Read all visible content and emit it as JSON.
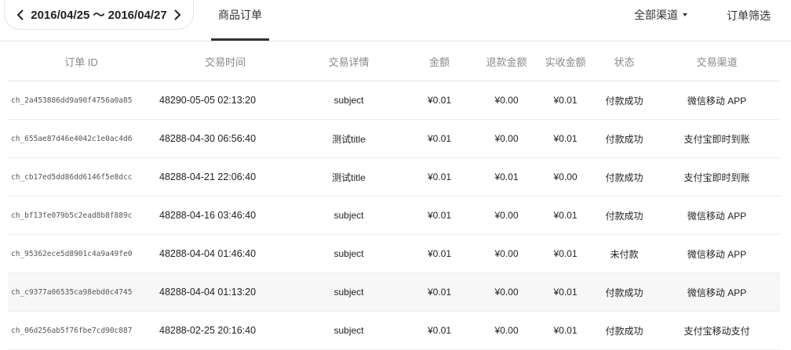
{
  "date_range": {
    "text": "2016/04/25 ～ 2016/04/27"
  },
  "tabs": {
    "active": "商品订单"
  },
  "controls": {
    "channel_dropdown": "全部渠道",
    "filter_button": "订单筛选"
  },
  "table": {
    "headers": [
      "订单 ID",
      "交易时间",
      "交易详情",
      "金额",
      "退款金额",
      "实收金额",
      "状态",
      "交易渠道"
    ],
    "rows": [
      {
        "id": "ch_2a453886dd9a90f4756a0a85",
        "time": "48290-05-05 02:13:20",
        "detail": "subject",
        "amount": "¥0.01",
        "refund": "¥0.00",
        "received": "¥0.01",
        "status": "付款成功",
        "channel": "微信移动 APP"
      },
      {
        "id": "ch_655ae87d46e4042c1e0ac4d6",
        "time": "48288-04-30 06:56:40",
        "detail": "测试title",
        "amount": "¥0.01",
        "refund": "¥0.00",
        "received": "¥0.01",
        "status": "付款成功",
        "channel": "支付宝即时到账"
      },
      {
        "id": "ch_cb17ed5dd86dd6146f5e8dcc",
        "time": "48288-04-21 22:06:40",
        "detail": "测试title",
        "amount": "¥0.01",
        "refund": "¥0.01",
        "received": "¥0.00",
        "status": "付款成功",
        "channel": "支付宝即时到账"
      },
      {
        "id": "ch_bf13fe079b5c2ead8b8f889c",
        "time": "48288-04-16 03:46:40",
        "detail": "subject",
        "amount": "¥0.01",
        "refund": "¥0.00",
        "received": "¥0.01",
        "status": "付款成功",
        "channel": "微信移动 APP"
      },
      {
        "id": "ch_95362ece5d8901c4a9a49fe0",
        "time": "48288-04-04 01:46:40",
        "detail": "subject",
        "amount": "¥0.01",
        "refund": "¥0.00",
        "received": "¥0.01",
        "status": "未付款",
        "channel": "微信移动 APP"
      },
      {
        "id": "ch_c9377a06535ca98ebd0c4745",
        "time": "48288-04-04 01:13:20",
        "detail": "subject",
        "amount": "¥0.01",
        "refund": "¥0.00",
        "received": "¥0.01",
        "status": "付款成功",
        "channel": "微信移动 APP"
      },
      {
        "id": "ch_06d256ab5f76fbe7cd90c887",
        "time": "48288-02-25 20:16:40",
        "detail": "subject",
        "amount": "¥0.01",
        "refund": "¥0.00",
        "received": "¥0.01",
        "status": "付款成功",
        "channel": "支付宝移动支付"
      }
    ]
  },
  "icons": {
    "prev": "chevron-left-icon",
    "next": "chevron-right-icon",
    "dropdown": "caret-down-icon"
  }
}
